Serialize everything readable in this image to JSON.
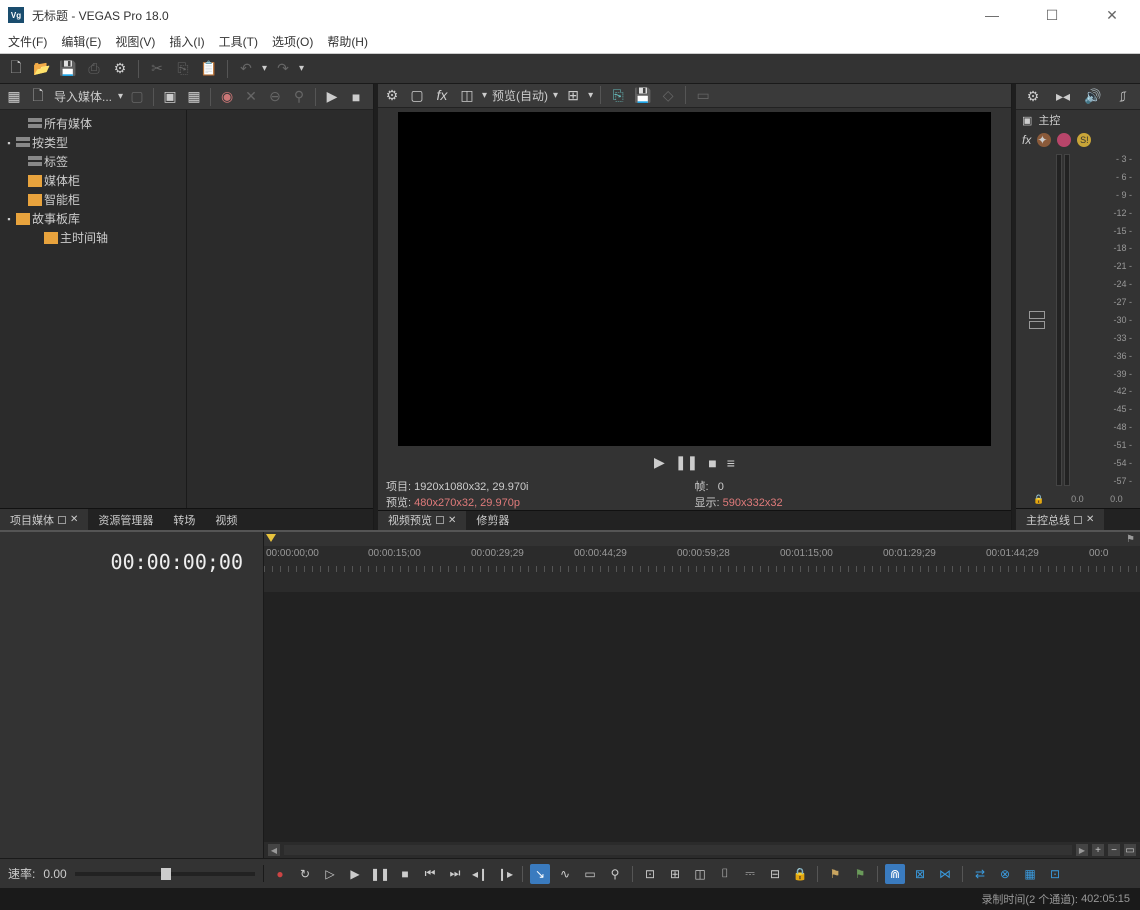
{
  "title": "无标题 - VEGAS Pro 18.0",
  "app_icon": "Vg",
  "menu": {
    "file": "文件(F)",
    "edit": "编辑(E)",
    "view": "视图(V)",
    "insert": "插入(I)",
    "tools": "工具(T)",
    "options": "选项(O)",
    "help": "帮助(H)"
  },
  "media": {
    "import_label": "导入媒体...",
    "tree": {
      "all_media": "所有媒体",
      "by_type": "按类型",
      "tags": "标签",
      "media_cabinet": "媒体柜",
      "smart_cabinet": "智能柜",
      "storyboard": "故事板库",
      "main_timeline": "主时间轴"
    }
  },
  "left_tabs": {
    "project_media": "项目媒体",
    "explorer": "资源管理器",
    "transitions": "转场",
    "videofx": "视频"
  },
  "preview": {
    "mode_label": "预览(自动)",
    "project_label": "项目:",
    "project_value": "1920x1080x32, 29.970i",
    "preview_label": "预览:",
    "preview_value": "480x270x32, 29.970p",
    "frame_label": "帧:",
    "frame_value": "0",
    "display_label": "显示:",
    "display_value": "590x332x32"
  },
  "preview_tabs": {
    "video_preview": "视频预览",
    "trimmer": "修剪器"
  },
  "master": {
    "title": "主控",
    "scale": [
      "- 3 -",
      "- 6 -",
      "- 9 -",
      "-12 -",
      "-15 -",
      "-18 -",
      "-21 -",
      "-24 -",
      "-27 -",
      "-30 -",
      "-33 -",
      "-36 -",
      "-39 -",
      "-42 -",
      "-45 -",
      "-48 -",
      "-51 -",
      "-54 -",
      "-57 -"
    ],
    "left_val": "0.0",
    "right_val": "0.0",
    "tab": "主控总线"
  },
  "timeline": {
    "current_time": "00:00:00;00",
    "ticks": [
      "00:00:00;00",
      "00:00:15;00",
      "00:00:29;29",
      "00:00:44;29",
      "00:00:59;28",
      "00:01:15;00",
      "00:01:29;29",
      "00:01:44;29",
      "00:0"
    ]
  },
  "rate": {
    "label": "速率:",
    "value": "0.00"
  },
  "status": {
    "record_label": "录制时间(2 个通道):",
    "record_value": "402:05:15"
  }
}
